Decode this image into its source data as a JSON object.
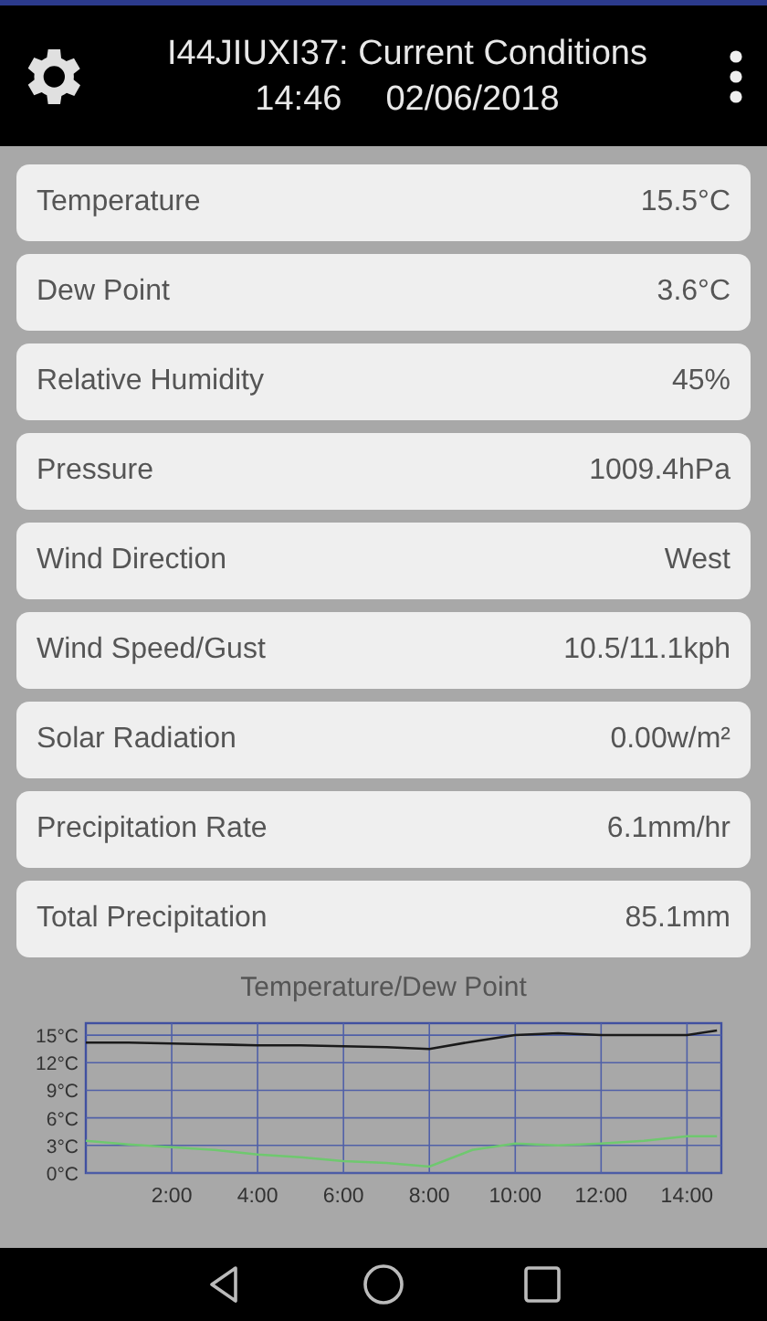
{
  "header": {
    "title": "I44JIUXI37: Current Conditions",
    "time": "14:46",
    "date": "02/06/2018"
  },
  "readings": [
    {
      "label": "Temperature",
      "value": "15.5°C"
    },
    {
      "label": "Dew Point",
      "value": "3.6°C"
    },
    {
      "label": "Relative Humidity",
      "value": "45%"
    },
    {
      "label": "Pressure",
      "value": "1009.4hPa"
    },
    {
      "label": "Wind Direction",
      "value": "West"
    },
    {
      "label": "Wind Speed/Gust",
      "value": "10.5/11.1kph"
    },
    {
      "label": "Solar Radiation",
      "value": "0.00w/m²"
    },
    {
      "label": "Precipitation Rate",
      "value": "6.1mm/hr"
    },
    {
      "label": "Total Precipitation",
      "value": "85.1mm"
    }
  ],
  "chart": {
    "chart_data": {
      "type": "line",
      "title": "Temperature/Dew Point",
      "x": [
        0,
        1,
        2,
        3,
        4,
        5,
        6,
        7,
        8,
        9,
        10,
        11,
        12,
        13,
        14,
        14.7
      ],
      "grid": true,
      "series": [
        {
          "color": "#1a1a1a",
          "values": [
            14.2,
            14.2,
            14.1,
            14.0,
            13.9,
            13.9,
            13.8,
            13.7,
            13.5,
            14.3,
            15.0,
            15.2,
            15.0,
            15.0,
            15.0,
            15.5
          ]
        },
        {
          "color": "#6fc86f",
          "values": [
            3.5,
            3.1,
            2.8,
            2.5,
            2.0,
            1.7,
            1.3,
            1.1,
            0.7,
            2.5,
            3.2,
            3.0,
            3.2,
            3.5,
            4.0,
            4.0
          ]
        }
      ],
      "xlim": [
        0,
        14.8
      ],
      "ylim": [
        0,
        16.3
      ],
      "xticks": [
        {
          "value": 2,
          "label": "2:00"
        },
        {
          "value": 4,
          "label": "4:00"
        },
        {
          "value": 6,
          "label": "6:00"
        },
        {
          "value": 8,
          "label": "8:00"
        },
        {
          "value": 10,
          "label": "10:00"
        },
        {
          "value": 12,
          "label": "12:00"
        },
        {
          "value": 14,
          "label": "14:00"
        }
      ],
      "yticks": [
        {
          "value": 0,
          "label": "0°C"
        },
        {
          "value": 3,
          "label": "3°C"
        },
        {
          "value": 6,
          "label": "6°C"
        },
        {
          "value": 9,
          "label": "9°C"
        },
        {
          "value": 12,
          "label": "12°C"
        },
        {
          "value": 15,
          "label": "15°C"
        }
      ]
    }
  }
}
